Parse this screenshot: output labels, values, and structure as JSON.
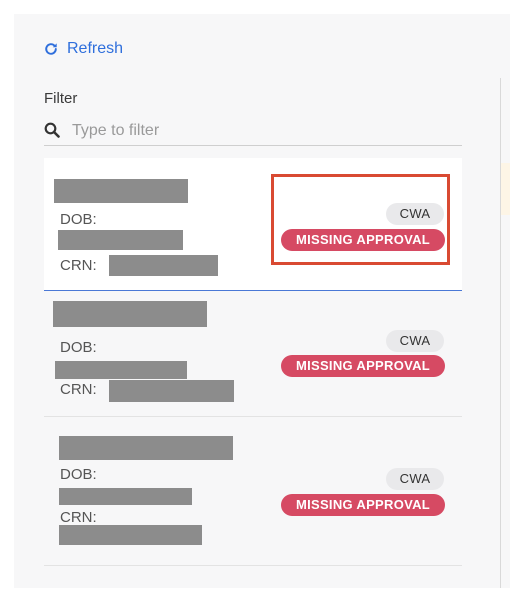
{
  "toolbar": {
    "refresh_label": "Refresh",
    "refresh_icon": "refresh-icon"
  },
  "filter": {
    "label": "Filter",
    "placeholder": "Type to filter",
    "value": "",
    "icon": "search-icon"
  },
  "records": [
    {
      "dob_label": "DOB:",
      "crn_label": "CRN:",
      "type_badge": "CWA",
      "status_badge": "MISSING APPROVAL",
      "selected": true
    },
    {
      "dob_label": "DOB:",
      "crn_label": "CRN:",
      "type_badge": "CWA",
      "status_badge": "MISSING APPROVAL",
      "selected": false
    },
    {
      "dob_label": "DOB:",
      "crn_label": "CRN:",
      "type_badge": "CWA",
      "status_badge": "MISSING APPROVAL",
      "selected": false
    }
  ],
  "colors": {
    "link_blue": "#2f6fdc",
    "status_red": "#d64a63",
    "highlight_red": "#d94a32",
    "selected_border": "#4a78d6"
  }
}
